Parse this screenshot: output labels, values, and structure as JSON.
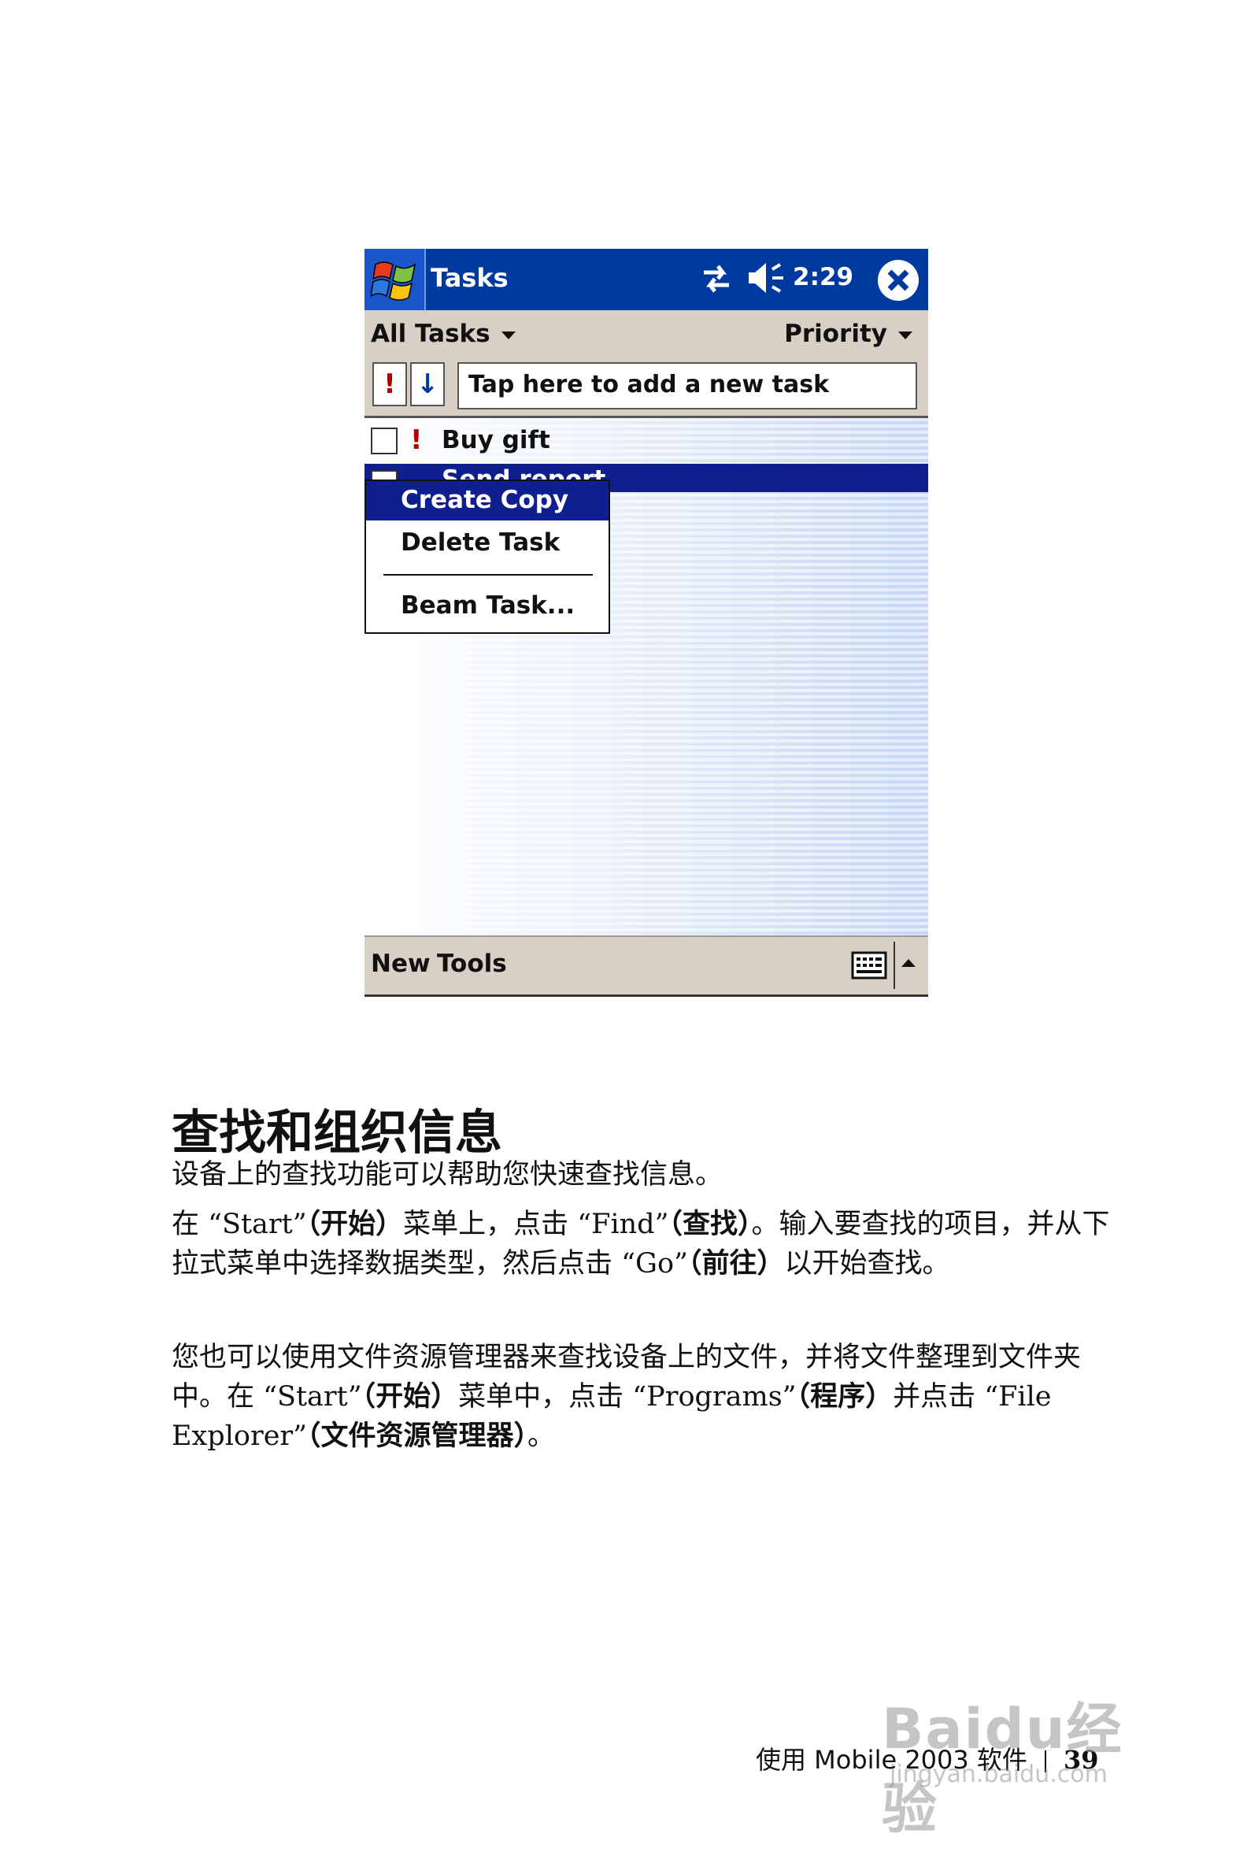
{
  "device": {
    "title": "Tasks",
    "clock": "2:29",
    "filter_label": "All Tasks",
    "sort_label": "Priority",
    "priority_button": "!",
    "direction_button": "↓",
    "new_task_placeholder": "Tap here to add a new task",
    "tasks": [
      {
        "name": "Buy gift",
        "priority": "!"
      },
      {
        "name": "Send report",
        "priority": ""
      }
    ],
    "context_menu": [
      "Create Copy",
      "Delete Task",
      "Beam Task..."
    ],
    "bottom_menu": {
      "new": "New",
      "tools": "Tools"
    },
    "icons": [
      "windows-start-icon",
      "connectivity-icon",
      "volume-icon",
      "close-icon",
      "keyboard-icon",
      "up-arrow-icon"
    ],
    "colors": {
      "titlebar": "#003a9e",
      "selection": "#0f1f8e",
      "chrome": "#d8d0c4",
      "priority": "#b00000"
    }
  },
  "doc": {
    "heading": "查找和组织信息",
    "p1": "设备上的查找功能可以帮助您快速查找信息。",
    "p2_a": "在 “Start”",
    "p2_b": "（开始）",
    "p2_c": "菜单上，点击 “Find”",
    "p2_d": "（查找）",
    "p2_e": "。输入要查找的项目，并从下拉式菜单中选择数据类型，然后点击 “Go”",
    "p2_f": "（前往）",
    "p2_g": "以开始查找。",
    "p3_a": "您也可以使用文件资源管理器来查找设备上的文件，并将文件整理到文件夹中。在 “Start”",
    "p3_b": "（开始）",
    "p3_c": "菜单中，点击 “Programs”",
    "p3_d": "（程序）",
    "p3_e": "并点击 “File Explorer”",
    "p3_f": "（文件资源管理器）",
    "p3_g": "。"
  },
  "footer": {
    "section": "使用 Mobile 2003 软件",
    "page": "39"
  },
  "watermark": {
    "logo": "Baidu经验",
    "url": "jingyan.baidu.com"
  }
}
